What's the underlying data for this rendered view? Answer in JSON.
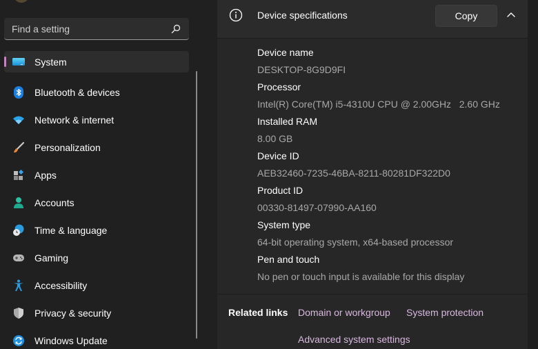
{
  "search": {
    "placeholder": "Find a setting",
    "icon": "search-icon"
  },
  "sidebar": {
    "items": [
      {
        "label": "System",
        "icon": "monitor-icon",
        "active": true
      },
      {
        "label": "Bluetooth & devices",
        "icon": "bluetooth-icon"
      },
      {
        "label": "Network & internet",
        "icon": "wifi-icon"
      },
      {
        "label": "Personalization",
        "icon": "paintbrush-icon"
      },
      {
        "label": "Apps",
        "icon": "apps-icon"
      },
      {
        "label": "Accounts",
        "icon": "person-icon"
      },
      {
        "label": "Time & language",
        "icon": "clock-globe-icon"
      },
      {
        "label": "Gaming",
        "icon": "gamepad-icon"
      },
      {
        "label": "Accessibility",
        "icon": "accessibility-icon"
      },
      {
        "label": "Privacy & security",
        "icon": "shield-icon"
      },
      {
        "label": "Windows Update",
        "icon": "update-icon"
      }
    ]
  },
  "device_specs": {
    "title": "Device specifications",
    "copy_label": "Copy",
    "expanded": true,
    "fields": [
      {
        "label": "Device name",
        "value": "DESKTOP-8G9D9FI"
      },
      {
        "label": "Processor",
        "value": "Intel(R) Core(TM) i5-4310U CPU @ 2.00GHz   2.60 GHz"
      },
      {
        "label": "Installed RAM",
        "value": "8.00 GB"
      },
      {
        "label": "Device ID",
        "value": "AEB32460-7235-46BA-8211-80281DF322D0"
      },
      {
        "label": "Product ID",
        "value": "00330-81497-07990-AA160"
      },
      {
        "label": "System type",
        "value": "64-bit operating system, x64-based processor"
      },
      {
        "label": "Pen and touch",
        "value": "No pen or touch input is available for this display"
      }
    ]
  },
  "related_links": {
    "title": "Related links",
    "links": [
      "Domain or workgroup",
      "System protection",
      "Advanced system settings"
    ]
  },
  "colors": {
    "accent": "#c586c0",
    "link": "#d9b8e0",
    "background": "#202020",
    "panel": "#272727"
  }
}
